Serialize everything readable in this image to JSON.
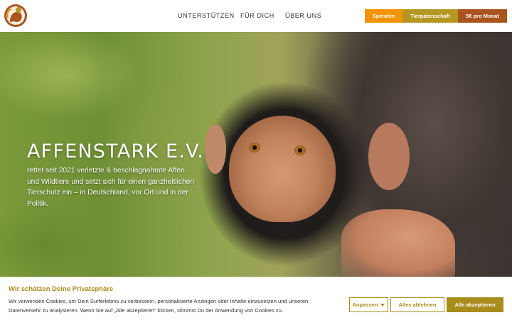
{
  "header": {
    "logo_icon": "affenstark-monkey-logo",
    "nav": [
      {
        "label": "UNTERSTÜTZEN"
      },
      {
        "label": "FÜR DICH"
      },
      {
        "label": "ÜBER UNS"
      }
    ],
    "cta": {
      "spenden": "Spenden",
      "patenschaft": "Tierpatenschaft",
      "monat": "5€ pro Monat"
    },
    "colors": {
      "spenden": "#f29400",
      "patenschaft": "#b39722",
      "monat": "#a9541d"
    }
  },
  "hero": {
    "title": "AFFENSTARK E.V.",
    "text": "rettet seit 2021 verletzte & beschlagnahmte Affen und Wildtiere und setzt sich für einen ganzheitlichen Tierschutz ein – in Deutschland, vor Ort und in der Politik."
  },
  "cookie": {
    "title": "Wir schätzen Deine Privatsphäre",
    "text": "Wir verwenden Cookies, um Dein Surferlebnis zu verbessern, personalisierte Anzeigen oder Inhalte einzusetzen und unseren Datenverkehr zu analysieren. Wenn Sie auf „Alle akzeptieren“ klicken, stimmst Du der Anwendung von Cookies zu.",
    "buttons": {
      "anpassen": "Anpassen",
      "ablehnen": "Alles ablehnen",
      "akzeptieren": "Alle akzeptieren"
    },
    "accent": "#a88c1c"
  }
}
